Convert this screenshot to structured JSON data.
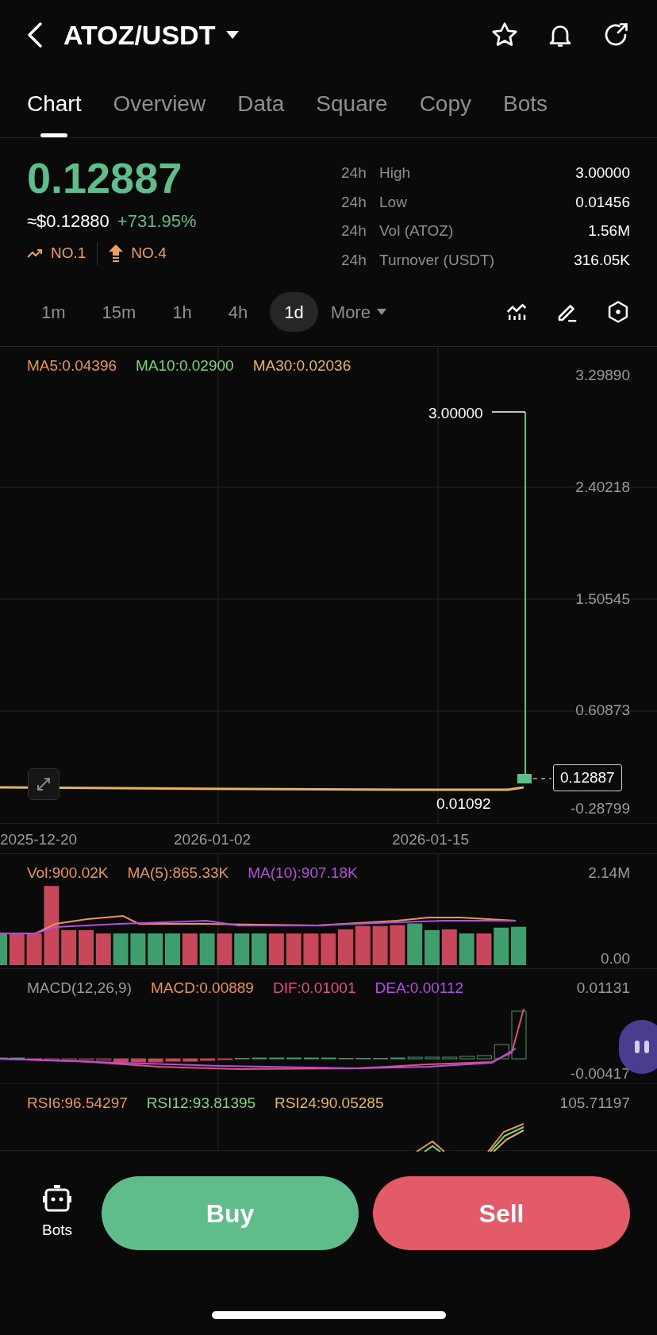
{
  "header": {
    "title": "ATOZ/USDT"
  },
  "tabs": [
    {
      "label": "Chart",
      "selected": true
    },
    {
      "label": "Overview",
      "selected": false
    },
    {
      "label": "Data",
      "selected": false
    },
    {
      "label": "Square",
      "selected": false
    },
    {
      "label": "Copy",
      "selected": false
    },
    {
      "label": "Bots",
      "selected": false
    }
  ],
  "price": {
    "last": "0.12887",
    "usd": "≈$0.12880",
    "change": "+731.95%",
    "ranks": [
      {
        "kind": "trending",
        "label": "NO.1"
      },
      {
        "kind": "gainer",
        "label": "NO.4"
      }
    ]
  },
  "stats": [
    {
      "period": "24h",
      "label": "High",
      "value": "3.00000"
    },
    {
      "period": "24h",
      "label": "Low",
      "value": "0.01456"
    },
    {
      "period": "24h",
      "label": "Vol (ATOZ)",
      "value": "1.56M"
    },
    {
      "period": "24h",
      "label": "Turnover (USDT)",
      "value": "316.05K"
    }
  ],
  "intervals": [
    {
      "label": "1m",
      "selected": false
    },
    {
      "label": "15m",
      "selected": false
    },
    {
      "label": "1h",
      "selected": false
    },
    {
      "label": "4h",
      "selected": false
    },
    {
      "label": "1d",
      "selected": true
    }
  ],
  "more": "More",
  "main_chart": {
    "legend": [
      {
        "text": "MA5:0.04396",
        "color": "#e8955a"
      },
      {
        "text": "MA10:0.02900",
        "color": "#7ed67a"
      },
      {
        "text": "MA30:0.02036",
        "color": "#e8b45a"
      }
    ],
    "y_labels": [
      "3.29890",
      "2.40218",
      "1.50545",
      "0.60873",
      "-0.28799"
    ],
    "high_label": "3.00000",
    "low_label": "0.01092",
    "last_price": "0.12887",
    "x_labels": [
      "2025-12-20",
      "2026-01-02",
      "2026-01-15"
    ]
  },
  "volume": {
    "legend": [
      {
        "text": "Vol:900.02K",
        "color": "#e8955a"
      },
      {
        "text": "MA(5):865.33K",
        "color": "#e8955a"
      },
      {
        "text": "MA(10):907.18K",
        "color": "#b24fe0"
      }
    ],
    "y_labels": [
      "2.14M",
      "0.00"
    ]
  },
  "macd": {
    "legend": [
      {
        "text": "MACD(12,26,9)",
        "color": "#9a9a9a"
      },
      {
        "text": "MACD:0.00889",
        "color": "#e8955a"
      },
      {
        "text": "DIF:0.01001",
        "color": "#e0507a"
      },
      {
        "text": "DEA:0.00112",
        "color": "#b24fe0"
      }
    ],
    "y_labels": [
      "0.01131",
      "-0.00417"
    ]
  },
  "rsi": {
    "legend": [
      {
        "text": "RSI6:96.54297",
        "color": "#e8955a"
      },
      {
        "text": "RSI12:93.81395",
        "color": "#7ed67a"
      },
      {
        "text": "RSI24:90.05285",
        "color": "#e8b45a"
      }
    ],
    "y_labels": [
      "105.71197"
    ]
  },
  "bottom": {
    "bots": "Bots",
    "buy": "Buy",
    "sell": "Sell"
  }
}
